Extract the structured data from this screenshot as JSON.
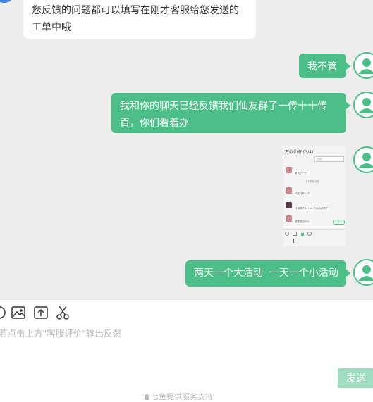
{
  "colors": {
    "accent": "#4cbf88",
    "chat_bg": "#ededee",
    "send_disabled": "#9fdcc0"
  },
  "messages": {
    "agent_1": "您反馈的问题都可以填写在刚才客服给您发送的工单中哦",
    "user_1": "我不管",
    "user_2": "我和你的聊天已经反馈我们仙友群了一传十十传百，你们看着办",
    "user_4": "两天一个大活动  一天一个小活动"
  },
  "screenshot_preview": {
    "title": "万妙仙府 (3/4)",
    "search": "搜索",
    "lines": [
      "收到了一个",
      "只能打开一下",
      "杯满离开15!  ok  不主动说明了",
      "哪里清洁卡么"
    ],
    "divider": "以下是新消息",
    "button": "去登录"
  },
  "toolbar": {
    "icons": [
      "emoji-icon",
      "image-icon",
      "upload-icon",
      "scissors-icon"
    ]
  },
  "input": {
    "placeholder": "若点击上方\"客服评价\"输出反馈"
  },
  "send_label": "发送",
  "footer": {
    "text": "七鱼提供服务支持"
  }
}
